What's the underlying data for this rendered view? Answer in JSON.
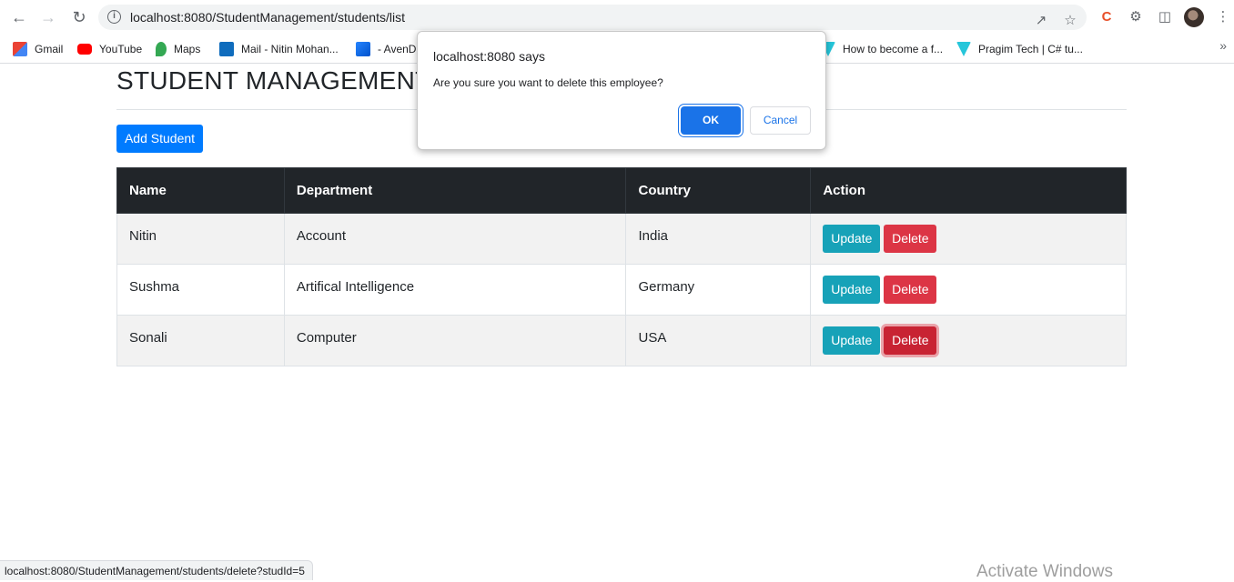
{
  "browser": {
    "url": "localhost:8080/StudentManagement/students/list",
    "bookmarks": [
      {
        "label": "Gmail",
        "icon": "gmail-icon"
      },
      {
        "label": "YouTube",
        "icon": "youtube-icon"
      },
      {
        "label": "Maps",
        "icon": "maps-icon"
      },
      {
        "label": "Mail - Nitin Mohan...",
        "icon": "outlook-icon"
      },
      {
        "label": "- AvenD",
        "icon": "jira-icon"
      },
      {
        "label": "How to become a f...",
        "icon": "bookmark-icon"
      },
      {
        "label": "Pragim Tech | C# tu...",
        "icon": "bookmark-icon"
      }
    ],
    "more_bookmarks": "»",
    "status_url": "localhost:8080/StudentManagement/students/delete?studId=5"
  },
  "page": {
    "title": "STUDENT MANAGEMENT",
    "add_button": "Add Student",
    "table": {
      "headers": [
        "Name",
        "Department",
        "Country",
        "Action"
      ],
      "rows": [
        {
          "name": "Nitin",
          "department": "Account",
          "country": "India"
        },
        {
          "name": "Sushma",
          "department": "Artifical Intelligence",
          "country": "Germany"
        },
        {
          "name": "Sonali",
          "department": "Computer",
          "country": "USA"
        }
      ],
      "update_label": "Update",
      "delete_label": "Delete"
    }
  },
  "dialog": {
    "title": "localhost:8080 says",
    "message": "Are you sure you want to delete this employee?",
    "ok": "OK",
    "cancel": "Cancel"
  },
  "watermark": "Activate Windows",
  "colors": {
    "primary": "#007bff",
    "info": "#17a2b8",
    "danger": "#dc3545",
    "header_dark": "#212529",
    "chrome_blue": "#1a73e8"
  }
}
